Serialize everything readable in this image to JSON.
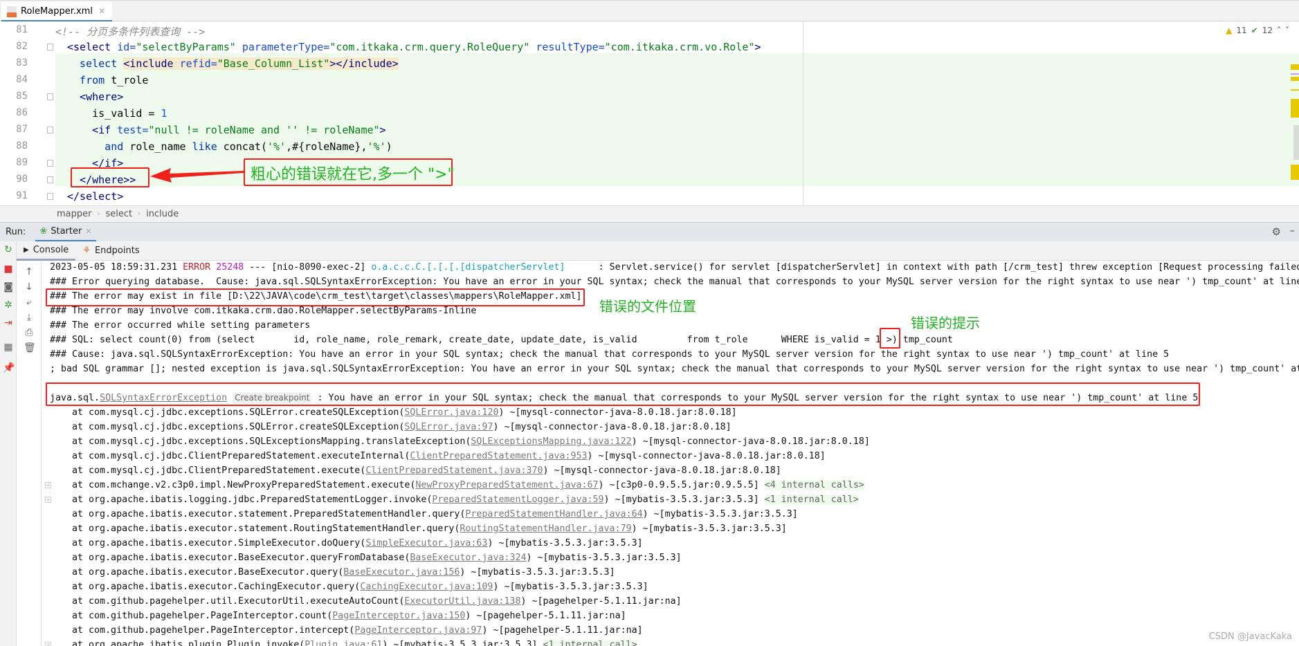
{
  "editor": {
    "tab_label": "RoleMapper.xml",
    "line_numbers": [
      "81",
      "82",
      "83",
      "84",
      "85",
      "86",
      "87",
      "88",
      "89",
      "90",
      "91"
    ],
    "lines": [
      [
        {
          "t": "<!-- 分页多条件列表查询 -->",
          "k": "comment"
        }
      ],
      [
        {
          "t": "<select ",
          "k": "tag"
        },
        {
          "t": "id=",
          "k": "attr"
        },
        {
          "t": "\"selectByParams\" ",
          "k": "val"
        },
        {
          "t": "parameterType=",
          "k": "attr"
        },
        {
          "t": "\"com.itkaka.crm.query.RoleQuery\" ",
          "k": "val"
        },
        {
          "t": "resultType=",
          "k": "attr"
        },
        {
          "t": "\"com.itkaka.crm.vo.Role\"",
          "k": "val"
        },
        {
          "t": ">",
          "k": "tag"
        }
      ],
      [
        {
          "t": "  select ",
          "k": "kw"
        },
        {
          "t": "<include ",
          "k": "tag incl"
        },
        {
          "t": "refid=",
          "k": "attr incl"
        },
        {
          "t": "\"Base_Column_List\"",
          "k": "val incl"
        },
        {
          "t": "></include>",
          "k": "tag incl"
        }
      ],
      [
        {
          "t": "  from ",
          "k": "kw"
        },
        {
          "t": "t_role",
          "k": "plain"
        }
      ],
      [
        {
          "t": "  <where>",
          "k": "tag"
        }
      ],
      [
        {
          "t": "    is_valid = ",
          "k": "plain"
        },
        {
          "t": "1",
          "k": "num"
        }
      ],
      [
        {
          "t": "    <if ",
          "k": "tag"
        },
        {
          "t": "test=",
          "k": "attr"
        },
        {
          "t": "\"null != roleName and '' != roleName\"",
          "k": "val"
        },
        {
          "t": ">",
          "k": "tag"
        }
      ],
      [
        {
          "t": "      and ",
          "k": "kw"
        },
        {
          "t": "role_name ",
          "k": "plain"
        },
        {
          "t": "like ",
          "k": "kw"
        },
        {
          "t": "concat(",
          "k": "plain"
        },
        {
          "t": "'%'",
          "k": "val"
        },
        {
          "t": ",#{roleName},",
          "k": "plain"
        },
        {
          "t": "'%'",
          "k": "val"
        },
        {
          "t": ")",
          "k": "plain"
        }
      ],
      [
        {
          "t": "    </if>",
          "k": "tag"
        }
      ],
      [
        {
          "t": "  </where>>",
          "k": "tag"
        }
      ],
      [
        {
          "t": "</select>",
          "k": "tag"
        }
      ]
    ],
    "warnings_count": "11",
    "typos_count": "12",
    "breadcrumb": [
      "mapper",
      "select",
      "include"
    ]
  },
  "annotations": {
    "code_note": "粗心的错误就在它,多一个 \">\"",
    "file_note": "错误的文件位置",
    "hint_note": "错误的提示"
  },
  "run": {
    "label": "Run:",
    "config_tab": "Starter",
    "tabs": [
      "Console",
      "Endpoints"
    ]
  },
  "console": {
    "lines": [
      [
        {
          "t": "2023-05-05 18:59:31.231 ",
          "k": ""
        },
        {
          "t": "ERROR",
          "k": "err"
        },
        {
          "t": " ",
          "k": ""
        },
        {
          "t": "25248",
          "k": "pid"
        },
        {
          "t": " --- [nio-8090-exec-2] ",
          "k": ""
        },
        {
          "t": "o.a.c.c.C.[.[.[.[dispatcherServlet]",
          "k": "logger"
        },
        {
          "t": "      : Servlet.service() for servlet [dispatcherServlet] in context with path [/crm_test] threw exception [Request processing failed",
          "k": ""
        }
      ],
      [
        {
          "t": "### Error querying database.  Cause: java.sql.SQLSyntaxErrorException: You have an error in your SQL syntax; check the manual that corresponds to your MySQL server version for the right syntax to use near ') tmp_count' at line",
          "k": ""
        }
      ],
      [
        {
          "t": "### The error may exist in file [D:\\22\\JAVA\\code\\crm_test\\target\\classes\\mappers\\RoleMapper.xml]",
          "k": ""
        }
      ],
      [
        {
          "t": "### The error may involve com.itkaka.crm.dao.RoleMapper.selectByParams-Inline",
          "k": ""
        }
      ],
      [
        {
          "t": "### The error occurred while setting parameters",
          "k": ""
        }
      ],
      [
        {
          "t": "### SQL: select count(0) from (select       id, role_name, role_remark, create_date, update_date, is_valid         from t_role      WHERE is_valid = 1 >) tmp_count",
          "k": ""
        }
      ],
      [
        {
          "t": "### Cause: java.sql.SQLSyntaxErrorException: You have an error in your SQL syntax; check the manual that corresponds to your MySQL server version for the right syntax to use near ') tmp_count' at line 5",
          "k": ""
        }
      ],
      [
        {
          "t": "; bad SQL grammar []; nested exception is java.sql.SQLSyntaxErrorException: You have an error in your SQL syntax; check the manual that corresponds to your MySQL server version for the right syntax to use near ') tmp_count' at",
          "k": ""
        }
      ],
      [],
      [
        {
          "t": "java.sql.",
          "k": ""
        },
        {
          "t": "SQLSyntaxErrorException",
          "k": "link"
        },
        {
          "t": " ",
          "k": ""
        },
        {
          "t": "Create breakpoint",
          "k": "bp"
        },
        {
          "t": " : You have an error in your SQL syntax; check the manual that corresponds to your MySQL server version for the right syntax to use near ') tmp_count' at line 5",
          "k": ""
        }
      ]
    ],
    "stack": [
      {
        "m": "com.mysql.cj.jdbc.exceptions.SQLError.createSQLException",
        "f": "SQLError.java:120",
        "j": "mysql-connector-java-8.0.18.jar:8.0.18"
      },
      {
        "m": "com.mysql.cj.jdbc.exceptions.SQLError.createSQLException",
        "f": "SQLError.java:97",
        "j": "mysql-connector-java-8.0.18.jar:8.0.18"
      },
      {
        "m": "com.mysql.cj.jdbc.exceptions.SQLExceptionsMapping.translateException",
        "f": "SQLExceptionsMapping.java:122",
        "j": "mysql-connector-java-8.0.18.jar:8.0.18"
      },
      {
        "m": "com.mysql.cj.jdbc.ClientPreparedStatement.executeInternal",
        "f": "ClientPreparedStatement.java:953",
        "j": "mysql-connector-java-8.0.18.jar:8.0.18"
      },
      {
        "m": "com.mysql.cj.jdbc.ClientPreparedStatement.execute",
        "f": "ClientPreparedStatement.java:370",
        "j": "mysql-connector-java-8.0.18.jar:8.0.18"
      },
      {
        "m": "com.mchange.v2.c3p0.impl.NewProxyPreparedStatement.execute",
        "f": "NewProxyPreparedStatement.java:67",
        "j": "c3p0-0.9.5.5.jar:0.9.5.5",
        "i": "<4 internal calls>",
        "fold": true
      },
      {
        "m": "org.apache.ibatis.logging.jdbc.PreparedStatementLogger.invoke",
        "f": "PreparedStatementLogger.java:59",
        "j": "mybatis-3.5.3.jar:3.5.3",
        "i": "<1 internal call>",
        "fold": true
      },
      {
        "m": "org.apache.ibatis.executor.statement.PreparedStatementHandler.query",
        "f": "PreparedStatementHandler.java:64",
        "j": "mybatis-3.5.3.jar:3.5.3"
      },
      {
        "m": "org.apache.ibatis.executor.statement.RoutingStatementHandler.query",
        "f": "RoutingStatementHandler.java:79",
        "j": "mybatis-3.5.3.jar:3.5.3"
      },
      {
        "m": "org.apache.ibatis.executor.SimpleExecutor.doQuery",
        "f": "SimpleExecutor.java:63",
        "j": "mybatis-3.5.3.jar:3.5.3"
      },
      {
        "m": "org.apache.ibatis.executor.BaseExecutor.queryFromDatabase",
        "f": "BaseExecutor.java:324",
        "j": "mybatis-3.5.3.jar:3.5.3"
      },
      {
        "m": "org.apache.ibatis.executor.BaseExecutor.query",
        "f": "BaseExecutor.java:156",
        "j": "mybatis-3.5.3.jar:3.5.3"
      },
      {
        "m": "org.apache.ibatis.executor.CachingExecutor.query",
        "f": "CachingExecutor.java:109",
        "j": "mybatis-3.5.3.jar:3.5.3"
      },
      {
        "m": "com.github.pagehelper.util.ExecutorUtil.executeAutoCount",
        "f": "ExecutorUtil.java:138",
        "j": "pagehelper-5.1.11.jar:na"
      },
      {
        "m": "com.github.pagehelper.PageInterceptor.count",
        "f": "PageInterceptor.java:150",
        "j": "pagehelper-5.1.11.jar:na"
      },
      {
        "m": "com.github.pagehelper.PageInterceptor.intercept",
        "f": "PageInterceptor.java:97",
        "j": "pagehelper-5.1.11.jar:na"
      },
      {
        "m": "org.apache.ibatis.plugin.Plugin.invoke",
        "f": "Plugin.java:61",
        "j": "mybatis-3.5.3.jar:3.5.3",
        "i": "<1 internal call>",
        "fold": true
      }
    ]
  },
  "watermark": "CSDN @JavacKaka",
  "colors": {
    "annotation_red": "#f0201a",
    "annotation_green": "#22b322",
    "highlight": "#edfaec"
  }
}
